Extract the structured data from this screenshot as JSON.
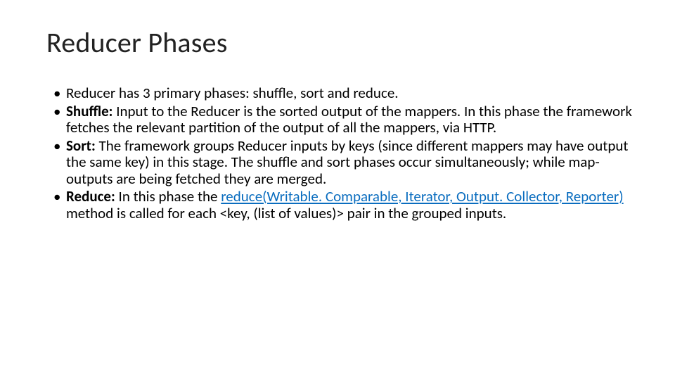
{
  "title": "Reducer Phases",
  "bullets": {
    "b1": "Reducer has 3 primary phases: shuffle, sort and reduce.",
    "b2_label": "Shuffle:",
    "b2_rest": "  Input to the Reducer is the sorted output of the mappers. In this phase the framework fetches the relevant partition of the output of all the mappers, via HTTP.",
    "b3_label": "Sort:",
    "b3_rest": "  The framework groups Reducer inputs by keys (since different mappers may have output the same key) in this stage.  The shuffle and sort phases occur simultaneously; while map-outputs are being fetched they are merged.",
    "b4_label": "Reduce:",
    "b4_before": " In this phase the ",
    "b4_link": "reduce(Writable. Comparable, Iterator, Output. Collector, Reporter)",
    "b4_after": " method is called for each <key, (list of values)> pair in the grouped inputs."
  }
}
